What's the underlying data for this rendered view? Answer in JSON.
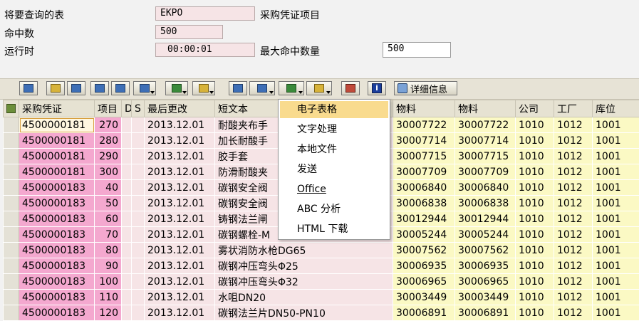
{
  "form": {
    "table_label": "将要查询的表",
    "table_value": "EKPO",
    "table_desc": "采购凭证项目",
    "hits_label": "命中数",
    "hits_value": "500",
    "runtime_label": "运行时",
    "runtime_value": "00:00:01",
    "max_hits_label": "最大命中数量",
    "max_hits_value": "500"
  },
  "toolbar": {
    "detail_label": "详细信息",
    "buttons": [
      "details-icon",
      "print-icon",
      "filter-icon",
      "find-icon",
      "find-next-icon",
      "set-filter-icon",
      "sum-icon",
      "subtotal-icon",
      "print-preview-icon",
      "views-icon",
      "export-icon",
      "layout-icon",
      "abc-analysis-icon",
      "info-icon"
    ]
  },
  "grid": {
    "columns": [
      "采购凭证",
      "项目",
      "D",
      "S",
      "最后更改",
      "短文本",
      "物料",
      "物料",
      "公司",
      "工厂",
      "库位"
    ],
    "rows": [
      [
        "4500000181",
        "270",
        "",
        "",
        "2013.12.01",
        "耐酸夹布手",
        "30007722",
        "30007722",
        "1010",
        "1012",
        "1001"
      ],
      [
        "4500000181",
        "280",
        "",
        "",
        "2013.12.01",
        "加长耐酸手",
        "30007714",
        "30007714",
        "1010",
        "1012",
        "1001"
      ],
      [
        "4500000181",
        "290",
        "",
        "",
        "2013.12.01",
        "胶手套",
        "30007715",
        "30007715",
        "1010",
        "1012",
        "1001"
      ],
      [
        "4500000181",
        "300",
        "",
        "",
        "2013.12.01",
        "防滑耐酸夹",
        "30007709",
        "30007709",
        "1010",
        "1012",
        "1001"
      ],
      [
        "4500000183",
        "40",
        "",
        "",
        "2013.12.01",
        "碳钢安全阀",
        "30006840",
        "30006840",
        "1010",
        "1012",
        "1001"
      ],
      [
        "4500000183",
        "50",
        "",
        "",
        "2013.12.01",
        "碳钢安全阀",
        "30006838",
        "30006838",
        "1010",
        "1012",
        "1001"
      ],
      [
        "4500000183",
        "60",
        "",
        "",
        "2013.12.01",
        "铸钢法兰闸",
        "30012944",
        "30012944",
        "1010",
        "1012",
        "1001"
      ],
      [
        "4500000183",
        "70",
        "",
        "",
        "2013.12.01",
        "碳钢螺栓-M",
        "30005244",
        "30005244",
        "1010",
        "1012",
        "1001"
      ],
      [
        "4500000183",
        "80",
        "",
        "",
        "2013.12.01",
        "雾状消防水枪DG65",
        "30007562",
        "30007562",
        "1010",
        "1012",
        "1001"
      ],
      [
        "4500000183",
        "90",
        "",
        "",
        "2013.12.01",
        "碳钢冲压弯头Φ25",
        "30006935",
        "30006935",
        "1010",
        "1012",
        "1001"
      ],
      [
        "4500000183",
        "100",
        "",
        "",
        "2013.12.01",
        "碳钢冲压弯头Φ32",
        "30006965",
        "30006965",
        "1010",
        "1012",
        "1001"
      ],
      [
        "4500000183",
        "110",
        "",
        "",
        "2013.12.01",
        "水咀DN20",
        "30003449",
        "30003449",
        "1010",
        "1012",
        "1001"
      ],
      [
        "4500000183",
        "120",
        "",
        "",
        "2013.12.01",
        "碳钢法兰片DN50-PN10",
        "30006891",
        "30006891",
        "1010",
        "1012",
        "1001"
      ]
    ]
  },
  "menu": {
    "items": [
      "电子表格",
      "文字处理",
      "本地文件",
      "发送",
      "Office",
      "ABC 分析",
      "HTML 下载"
    ]
  }
}
